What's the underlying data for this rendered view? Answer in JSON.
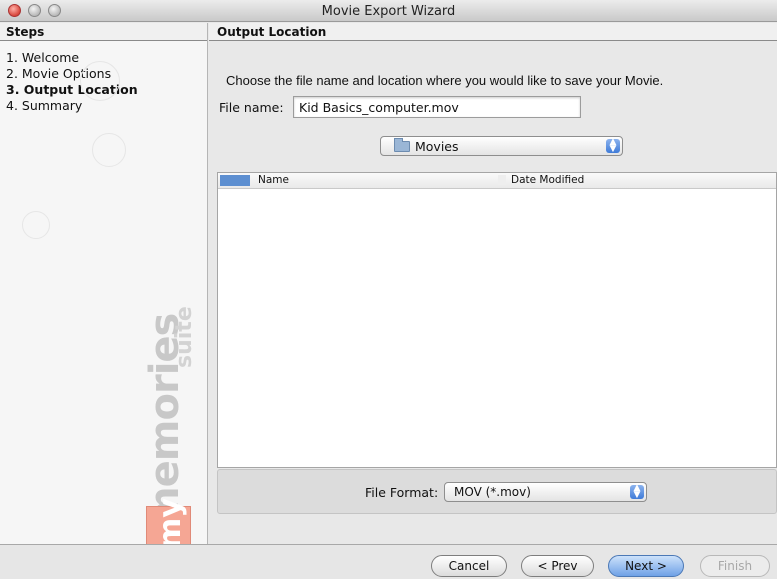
{
  "window": {
    "title": "Movie Export Wizard"
  },
  "steps": {
    "header": "Steps",
    "items": [
      {
        "label": "1. Welcome",
        "active": false
      },
      {
        "label": "2. Movie Options",
        "active": false
      },
      {
        "label": "3. Output Location",
        "active": true
      },
      {
        "label": "4. Summary",
        "active": false
      }
    ]
  },
  "branding": {
    "my": "my",
    "memories": "memories",
    "suite": "suite"
  },
  "main": {
    "header": "Output Location",
    "instruction": "Choose the file name and location where you would like to save your Movie.",
    "file_name_label": "File name:",
    "file_name_value": "Kid Basics_computer.mov",
    "location_selected": "Movies",
    "columns": {
      "name": "Name",
      "date": "Date Modified"
    },
    "file_format_label": "File Format:",
    "file_format_value": "MOV (*.mov)"
  },
  "buttons": {
    "cancel": "Cancel",
    "prev": "< Prev",
    "next": "Next >",
    "finish": "Finish"
  },
  "colors": {
    "accent": "#5d8fd1",
    "logo_pink": "#f5a694"
  }
}
